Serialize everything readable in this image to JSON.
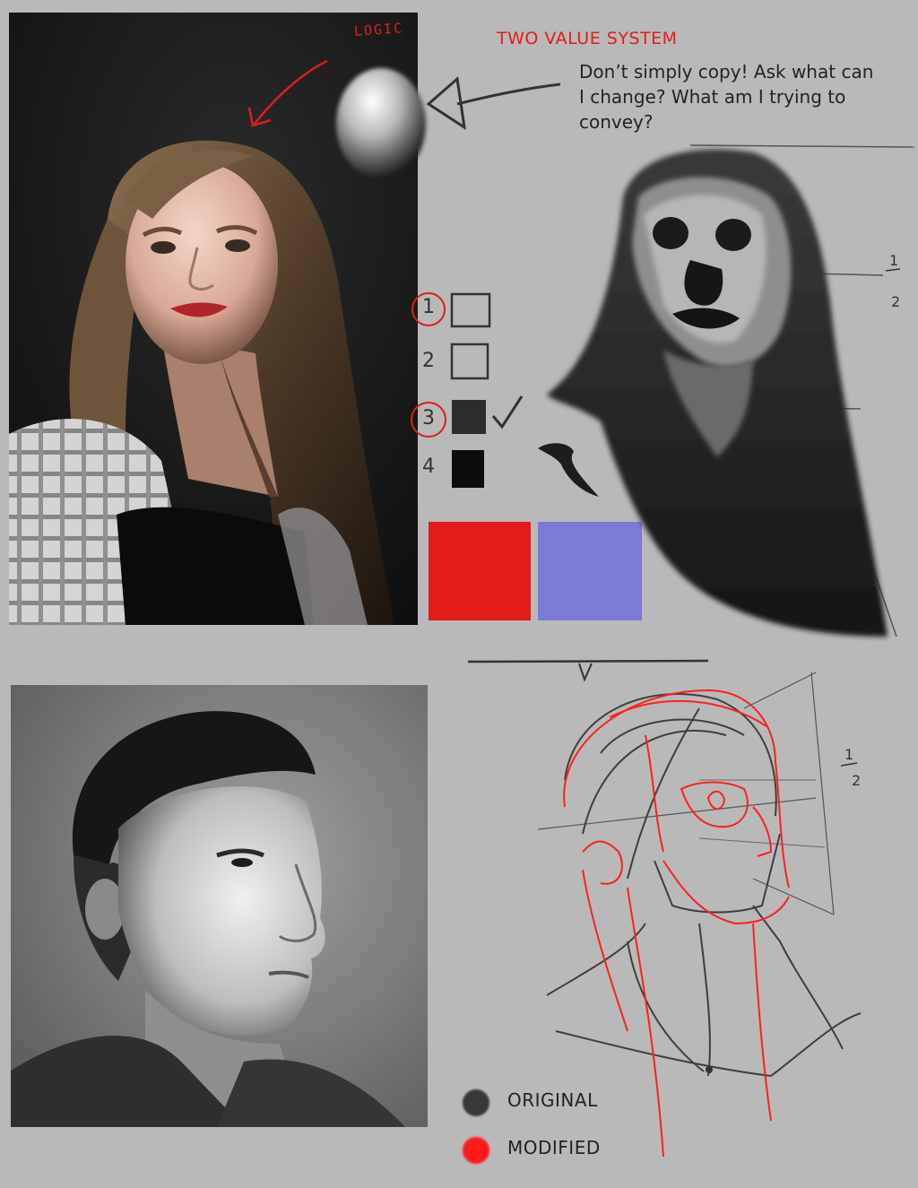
{
  "heading": {
    "title": "TWO VALUE SYSTEM",
    "handwritten_note": "LOGIC"
  },
  "note": {
    "text": "Don’t simply copy!  Ask what can I change?  What am I trying to convey?"
  },
  "value_scale": {
    "items": [
      {
        "number": "1",
        "circled": true,
        "value": "empty"
      },
      {
        "number": "2",
        "circled": false,
        "value": "empty"
      },
      {
        "number": "3",
        "circled": true,
        "value": "dark",
        "checked": true
      },
      {
        "number": "4",
        "circled": false,
        "value": "black"
      }
    ]
  },
  "color_swatches": {
    "warm": "#e51b1b",
    "cool": "#7a7ad4"
  },
  "proportion_marks": {
    "upper": "1/2",
    "lower": "1/2"
  },
  "legend": {
    "items": [
      {
        "label": "ORIGINAL",
        "color": "#383838"
      },
      {
        "label": "MODIFIED",
        "color": "#ff1a1a"
      }
    ]
  }
}
